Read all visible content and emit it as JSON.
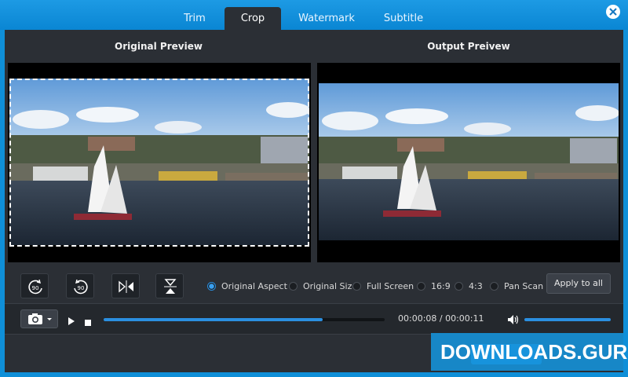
{
  "tabs": [
    {
      "label": "Trim",
      "active": false
    },
    {
      "label": "Crop",
      "active": true
    },
    {
      "label": "Watermark",
      "active": false
    },
    {
      "label": "Subtitle",
      "active": false
    }
  ],
  "previews": {
    "original_title": "Original Preview",
    "output_title": "Output Preivew"
  },
  "tools": {
    "rotate_left": "rotate-left-90-icon",
    "rotate_right": "rotate-right-90-icon",
    "flip_horizontal": "flip-horizontal-icon",
    "flip_vertical": "flip-vertical-icon",
    "rotate_left_text": "90",
    "rotate_right_text": "90"
  },
  "aspect_options": [
    {
      "label": "Original Aspect",
      "selected": true
    },
    {
      "label": "Original Size",
      "selected": false
    },
    {
      "label": "Full Screen",
      "selected": false
    },
    {
      "label": "16:9",
      "selected": false
    },
    {
      "label": "4:3",
      "selected": false
    },
    {
      "label": "Pan Scan",
      "selected": false
    }
  ],
  "apply_all_label": "Apply to all",
  "playback": {
    "current_time": "00:00:08",
    "total_time": "00:00:11",
    "time_display": "00:00:08 / 00:00:11",
    "progress": 0.78,
    "volume": 1.0
  },
  "watermark_text": "DOWNLOADS.GURU",
  "colors": {
    "accent": "#2b8fe0",
    "header": "#0f8fd8",
    "panel": "#2b2f35"
  }
}
